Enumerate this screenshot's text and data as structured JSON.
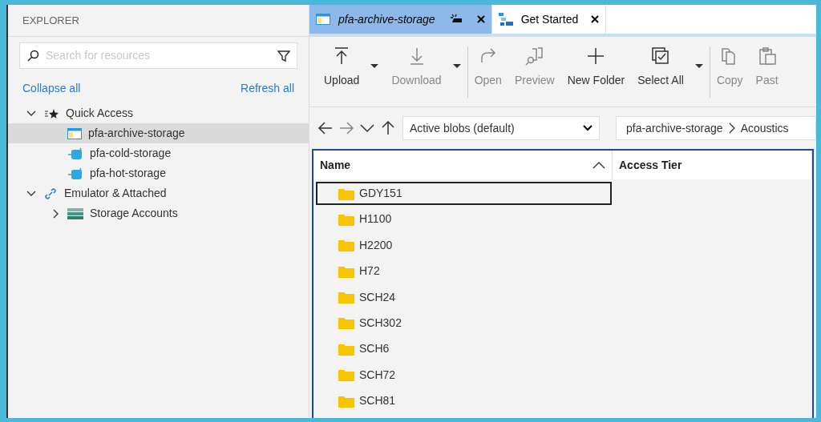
{
  "explorer": {
    "title": "EXPLORER",
    "search": {
      "placeholder": "Search for resources"
    },
    "collapse_all": "Collapse all",
    "refresh_all": "Refresh all",
    "tree": [
      {
        "label": "Quick Access",
        "kind": "quick",
        "expanded": true,
        "selected": false,
        "children": [
          {
            "label": "pfa-archive-storage",
            "kind": "archive",
            "selected": true
          },
          {
            "label": "pfa-cold-storage",
            "kind": "account",
            "selected": false
          },
          {
            "label": "pfa-hot-storage",
            "kind": "account",
            "selected": false
          }
        ]
      },
      {
        "label": "Emulator & Attached",
        "kind": "link",
        "expanded": true,
        "selected": false,
        "children": [
          {
            "label": "Storage Accounts",
            "kind": "accounts",
            "expanded": false,
            "selected": false
          }
        ]
      }
    ]
  },
  "tabs": [
    {
      "label": "pfa-archive-storage",
      "kind": "archive",
      "selected": true
    },
    {
      "label": "Get Started",
      "kind": "start",
      "selected": false
    }
  ],
  "toolbar": [
    {
      "label": "Upload",
      "kind": "upload",
      "disabled": false,
      "dropdown": true
    },
    {
      "label": "Download",
      "kind": "download",
      "disabled": true,
      "dropdown": true
    },
    {
      "label": "Open",
      "kind": "open",
      "disabled": true,
      "dropdown": false
    },
    {
      "label": "Preview",
      "kind": "preview",
      "disabled": true,
      "dropdown": false
    },
    {
      "label": "New Folder",
      "kind": "plus",
      "disabled": false,
      "dropdown": false
    },
    {
      "label": "Select All",
      "kind": "select",
      "disabled": false,
      "dropdown": true
    },
    {
      "label": "Copy",
      "kind": "copy",
      "disabled": true,
      "dropdown": false
    },
    {
      "label": "Past",
      "kind": "paste",
      "disabled": true,
      "dropdown": false
    }
  ],
  "nav": {
    "back": {
      "disabled": false
    },
    "forward": {
      "disabled": true
    },
    "view": "Active blobs (default)",
    "breadcrumb": [
      "pfa-archive-storage",
      "Acoustics"
    ]
  },
  "table": {
    "columns": [
      "Name",
      "Access Tier"
    ],
    "rows": [
      {
        "name": "GDY151",
        "selected": true
      },
      {
        "name": "H1100",
        "selected": false
      },
      {
        "name": "H2200",
        "selected": false
      },
      {
        "name": "H72",
        "selected": false
      },
      {
        "name": "SCH24",
        "selected": false
      },
      {
        "name": "SCH302",
        "selected": false
      },
      {
        "name": "SCH6",
        "selected": false
      },
      {
        "name": "SCH72",
        "selected": false
      },
      {
        "name": "SCH81",
        "selected": false
      }
    ]
  }
}
